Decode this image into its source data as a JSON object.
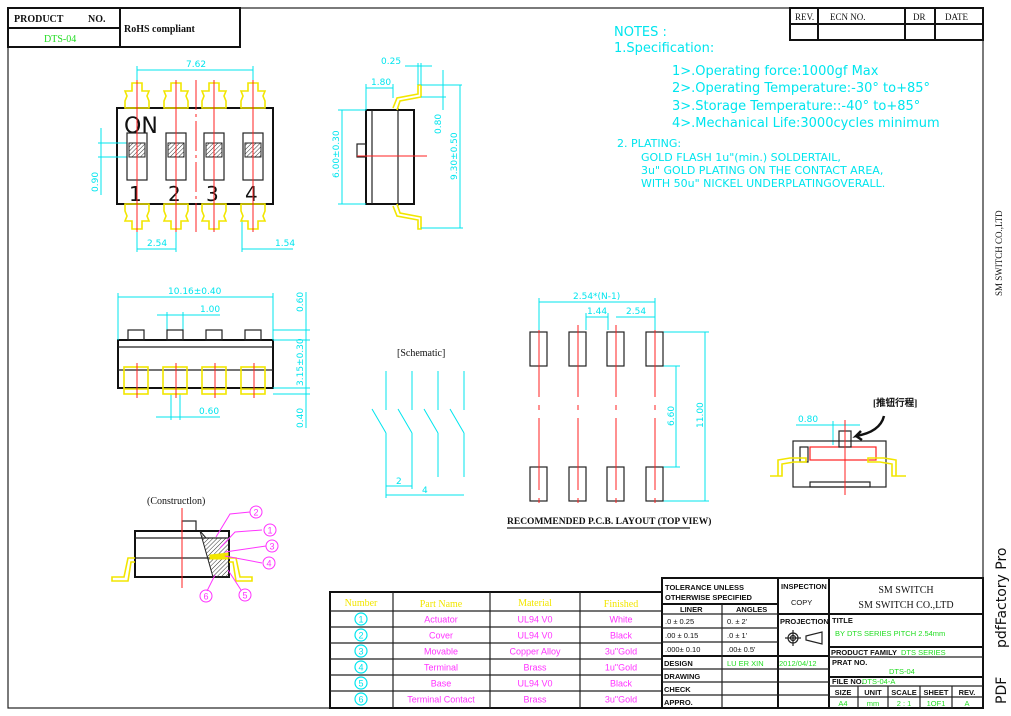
{
  "header": {
    "product_label": "PRODUCT",
    "no_label": "NO.",
    "product_no": "DTS-04",
    "rohs": "RoHS compliant",
    "rev_table": {
      "columns": [
        "REV.",
        "ECN NO.",
        "DR",
        "DATE"
      ]
    }
  },
  "notes": {
    "title": "NOTES :",
    "spec_title": "1.Specification:",
    "spec_items": [
      "1>.Operating force:1000gf Max",
      "2>.Operating Temperature:-30° to+85°",
      "3>.Storage Temperature::-40° to+85°",
      "4>.Mechanical Life:3000cycles minimum"
    ],
    "plating_title": "2. PLATING:",
    "plating_lines": [
      "GOLD FLASH 1u\"(min.) SOLDERTAIL,",
      "3u\" GOLD PLATING  ON THE CONTACT AREA,",
      "WITH 50u\" NICKEL UNDERPLATINGOVERALL."
    ]
  },
  "top_view": {
    "on_label": "ON",
    "switch_numbers": [
      "1",
      "2",
      "3",
      "4"
    ],
    "dims": {
      "width": "7.62",
      "pitch": "2.54",
      "edge": "1.54",
      "actuator": "0.90"
    }
  },
  "side_view": {
    "dims": {
      "lead": "0.25",
      "offset": "1.80",
      "body": "6.00±0.30",
      "standoff": "0.80",
      "overall": "9.30±0.50"
    }
  },
  "front_view": {
    "dims": {
      "length": "10.16±0.40",
      "knob": "1.00",
      "terminal": "0.60",
      "top": "0.60",
      "height": "3.15±0.30",
      "bottom": "0.40"
    }
  },
  "schematic": {
    "label": "[Schematic]",
    "dims": {
      "a": "2",
      "b": "4"
    }
  },
  "pcb": {
    "caption": "RECOMMENDED P.C.B. LAYOUT (TOP VIEW)",
    "dims": {
      "span": "2.54*(N-1)",
      "gap": "1.44",
      "pitch": "2.54",
      "inner": "6.60",
      "outer": "11.00"
    }
  },
  "travel": {
    "label": "[推钮行程]",
    "dim": "0.80"
  },
  "construction": {
    "label": "(Constructlon)",
    "callouts": [
      "2",
      "1",
      "3",
      "4",
      "5",
      "6"
    ]
  },
  "parts_table": {
    "columns": [
      "Number",
      "Part Name",
      "Material",
      "Finished"
    ],
    "rows": [
      {
        "number": "1",
        "name": "Actuator",
        "material": "UL94 V0",
        "finished": "White"
      },
      {
        "number": "2",
        "name": "Cover",
        "material": "UL94 V0",
        "finished": "Black"
      },
      {
        "number": "3",
        "name": "Movable",
        "material": "Copper Alloy",
        "finished": "3u\"Gold"
      },
      {
        "number": "4",
        "name": "Terminal",
        "material": "Brass",
        "finished": "1u\"Gold"
      },
      {
        "number": "5",
        "name": "Base",
        "material": "UL94 V0",
        "finished": "Black"
      },
      {
        "number": "6",
        "name": "Terminal Contact",
        "material": "Brass",
        "finished": "3u\"Gold"
      }
    ]
  },
  "title_block": {
    "tolerance_1": "TOLERANCE UNLESS",
    "tolerance_2": "OTHERWISE SPECIFIED",
    "liner": "LINER",
    "angles": "ANGLES",
    "tol_rows": [
      {
        "liner": ".0   ±  0.25",
        "angle": "0.  ±    2'"
      },
      {
        "liner": ".00  ±  0.15",
        "angle": ".0  ±    1'"
      },
      {
        "liner": ".000±  0.10",
        "angle": ".00±   0.5'"
      }
    ],
    "inspection": "INSPECTION",
    "copy": "COPY",
    "projection": "PROJECTION",
    "design": "DESIGN",
    "designer": "LU ER XIN",
    "date": "2012/04/12",
    "drawing": "DRAWING",
    "check": "CHECK",
    "appro": "APPRO.",
    "company_1": "SM SWITCH",
    "company_2": "SM SWITCH CO.,LTD",
    "title_label": "TITLE",
    "title_value": "BY DTS SERIES PITCH 2.54mm",
    "family_label": "PRODUCT FAMILY",
    "family_value": "DTS SERIES",
    "prat_label": "PRAT NO.",
    "prat_value": "DTS-04",
    "file_label": "FILE NO.",
    "file_value": "DTS-04-A",
    "size_headers": [
      "SIZE",
      "UNIT",
      "SCALE",
      "SHEET",
      "REV."
    ],
    "size_values": [
      "A4",
      "mm",
      "2 : 1",
      "1OF1",
      "A"
    ]
  },
  "margin": {
    "company": "SM SWITCH CO.,LTD",
    "watermark_1": "PDF",
    "watermark_2": "pdfFactory Pro"
  },
  "colors": {
    "dimension": "#00e5ee",
    "lead": "#f2e600",
    "centerline": "#ff2020",
    "callout": "#ff33ff",
    "value": "#22dd22"
  }
}
